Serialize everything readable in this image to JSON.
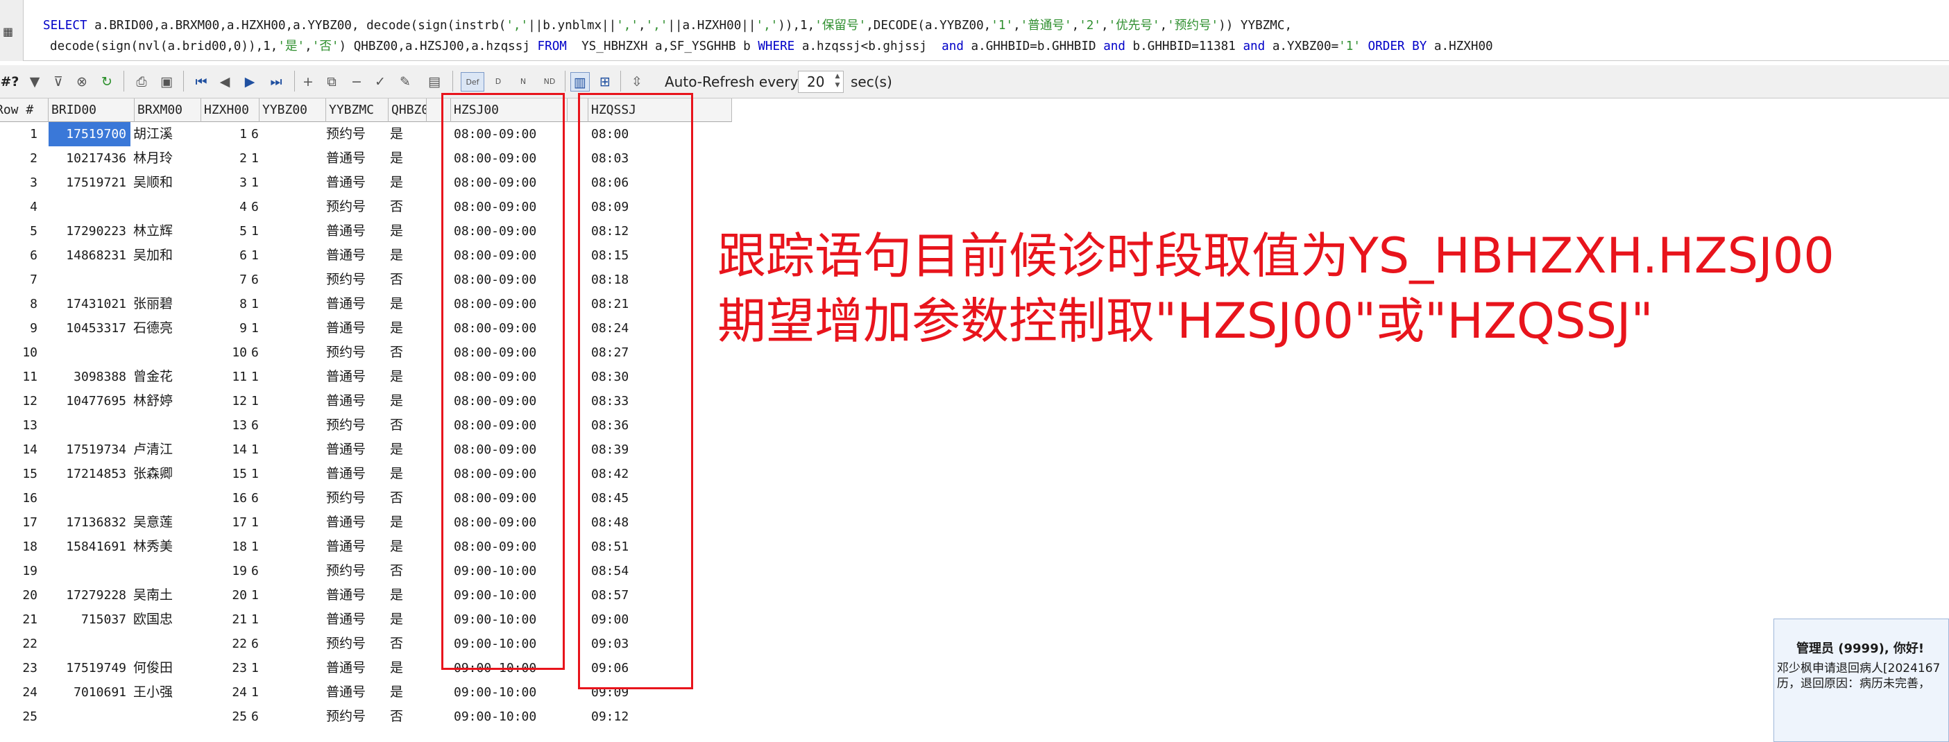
{
  "sql": {
    "line1": [
      {
        "t": "SELECT",
        "c": "kw"
      },
      {
        "t": " a.BRID00,a.BRXM00,a.HZXH00,a.YYBZ00, decode(sign(instrb(",
        "c": ""
      },
      {
        "t": "','",
        "c": "str"
      },
      {
        "t": "||b.ynblmx||",
        "c": ""
      },
      {
        "t": "','",
        "c": "str"
      },
      {
        "t": ",",
        "c": ""
      },
      {
        "t": "','",
        "c": "str"
      },
      {
        "t": "||a.HZXH00||",
        "c": ""
      },
      {
        "t": "','",
        "c": "str"
      },
      {
        "t": ")),1,",
        "c": ""
      },
      {
        "t": "'保留号'",
        "c": "str"
      },
      {
        "t": ",DECODE(a.YYBZ00,",
        "c": ""
      },
      {
        "t": "'1'",
        "c": "str"
      },
      {
        "t": ",",
        "c": ""
      },
      {
        "t": "'普通号'",
        "c": "str"
      },
      {
        "t": ",",
        "c": ""
      },
      {
        "t": "'2'",
        "c": "str"
      },
      {
        "t": ",",
        "c": ""
      },
      {
        "t": "'优先号'",
        "c": "str"
      },
      {
        "t": ",",
        "c": ""
      },
      {
        "t": "'预约号'",
        "c": "str"
      },
      {
        "t": ")) YYBZMC,",
        "c": ""
      }
    ],
    "line2": [
      {
        "t": "decode(sign(nvl(a.brid00,0)),1,",
        "c": ""
      },
      {
        "t": "'是'",
        "c": "str"
      },
      {
        "t": ",",
        "c": ""
      },
      {
        "t": "'否'",
        "c": "str"
      },
      {
        "t": ") QHBZ00,a.HZSJ00,a.hzqssj ",
        "c": ""
      },
      {
        "t": "FROM",
        "c": "kw"
      },
      {
        "t": "  YS_HBHZXH a,SF_YSGHHB b ",
        "c": ""
      },
      {
        "t": "WHERE",
        "c": "kw"
      },
      {
        "t": " a.hzqssj<b.ghjssj  ",
        "c": ""
      },
      {
        "t": "and",
        "c": "kw"
      },
      {
        "t": " a.GHHBID=b.GHHBID ",
        "c": ""
      },
      {
        "t": "and",
        "c": "kw"
      },
      {
        "t": " b.GHHBID=11381 ",
        "c": ""
      },
      {
        "t": "and",
        "c": "kw"
      },
      {
        "t": " a.YXBZ00=",
        "c": ""
      },
      {
        "t": "'1'",
        "c": "str"
      },
      {
        "t": " ",
        "c": ""
      },
      {
        "t": "ORDER BY",
        "c": "kw"
      },
      {
        "t": " a.HZXH00",
        "c": ""
      }
    ]
  },
  "toolbar": {
    "row_count_label": "#?",
    "auto_refresh_label": "Auto-Refresh every",
    "refresh_interval": "20",
    "refresh_unit": "sec(s)",
    "def_label": "Def",
    "d_label": "D",
    "n_label": "N",
    "nd_label": "ND"
  },
  "grid": {
    "columns": [
      "Row #",
      "BRID00",
      "BRXM00",
      "HZXH00",
      "YYBZ00",
      "YYBZMC",
      "QHBZ00",
      "",
      "HZSJ00",
      "",
      "HZQSSJ"
    ],
    "rows": [
      {
        "row": "1",
        "brid": "17519700",
        "name": "胡江溪",
        "hzxh": "1",
        "yybz": "6",
        "mc": "预约号",
        "qh": "是",
        "hzsj": "08:00-09:00",
        "qssj": "08:00"
      },
      {
        "row": "2",
        "brid": "10217436",
        "name": "林月玲",
        "hzxh": "2",
        "yybz": "1",
        "mc": "普通号",
        "qh": "是",
        "hzsj": "08:00-09:00",
        "qssj": "08:03"
      },
      {
        "row": "3",
        "brid": "17519721",
        "name": "吴顺和",
        "hzxh": "3",
        "yybz": "1",
        "mc": "普通号",
        "qh": "是",
        "hzsj": "08:00-09:00",
        "qssj": "08:06"
      },
      {
        "row": "4",
        "brid": "",
        "name": "",
        "hzxh": "4",
        "yybz": "6",
        "mc": "预约号",
        "qh": "否",
        "hzsj": "08:00-09:00",
        "qssj": "08:09"
      },
      {
        "row": "5",
        "brid": "17290223",
        "name": "林立辉",
        "hzxh": "5",
        "yybz": "1",
        "mc": "普通号",
        "qh": "是",
        "hzsj": "08:00-09:00",
        "qssj": "08:12"
      },
      {
        "row": "6",
        "brid": "14868231",
        "name": "吴加和",
        "hzxh": "6",
        "yybz": "1",
        "mc": "普通号",
        "qh": "是",
        "hzsj": "08:00-09:00",
        "qssj": "08:15"
      },
      {
        "row": "7",
        "brid": "",
        "name": "",
        "hzxh": "7",
        "yybz": "6",
        "mc": "预约号",
        "qh": "否",
        "hzsj": "08:00-09:00",
        "qssj": "08:18"
      },
      {
        "row": "8",
        "brid": "17431021",
        "name": "张丽碧",
        "hzxh": "8",
        "yybz": "1",
        "mc": "普通号",
        "qh": "是",
        "hzsj": "08:00-09:00",
        "qssj": "08:21"
      },
      {
        "row": "9",
        "brid": "10453317",
        "name": "石德亮",
        "hzxh": "9",
        "yybz": "1",
        "mc": "普通号",
        "qh": "是",
        "hzsj": "08:00-09:00",
        "qssj": "08:24"
      },
      {
        "row": "10",
        "brid": "",
        "name": "",
        "hzxh": "10",
        "yybz": "6",
        "mc": "预约号",
        "qh": "否",
        "hzsj": "08:00-09:00",
        "qssj": "08:27"
      },
      {
        "row": "11",
        "brid": "3098388",
        "name": "曾金花",
        "hzxh": "11",
        "yybz": "1",
        "mc": "普通号",
        "qh": "是",
        "hzsj": "08:00-09:00",
        "qssj": "08:30"
      },
      {
        "row": "12",
        "brid": "10477695",
        "name": "林舒婷",
        "hzxh": "12",
        "yybz": "1",
        "mc": "普通号",
        "qh": "是",
        "hzsj": "08:00-09:00",
        "qssj": "08:33"
      },
      {
        "row": "13",
        "brid": "",
        "name": "",
        "hzxh": "13",
        "yybz": "6",
        "mc": "预约号",
        "qh": "否",
        "hzsj": "08:00-09:00",
        "qssj": "08:36"
      },
      {
        "row": "14",
        "brid": "17519734",
        "name": "卢清江",
        "hzxh": "14",
        "yybz": "1",
        "mc": "普通号",
        "qh": "是",
        "hzsj": "08:00-09:00",
        "qssj": "08:39"
      },
      {
        "row": "15",
        "brid": "17214853",
        "name": "张森卿",
        "hzxh": "15",
        "yybz": "1",
        "mc": "普通号",
        "qh": "是",
        "hzsj": "08:00-09:00",
        "qssj": "08:42"
      },
      {
        "row": "16",
        "brid": "",
        "name": "",
        "hzxh": "16",
        "yybz": "6",
        "mc": "预约号",
        "qh": "否",
        "hzsj": "08:00-09:00",
        "qssj": "08:45"
      },
      {
        "row": "17",
        "brid": "17136832",
        "name": "吴意莲",
        "hzxh": "17",
        "yybz": "1",
        "mc": "普通号",
        "qh": "是",
        "hzsj": "08:00-09:00",
        "qssj": "08:48"
      },
      {
        "row": "18",
        "brid": "15841691",
        "name": "林秀美",
        "hzxh": "18",
        "yybz": "1",
        "mc": "普通号",
        "qh": "是",
        "hzsj": "08:00-09:00",
        "qssj": "08:51"
      },
      {
        "row": "19",
        "brid": "",
        "name": "",
        "hzxh": "19",
        "yybz": "6",
        "mc": "预约号",
        "qh": "否",
        "hzsj": "09:00-10:00",
        "qssj": "08:54"
      },
      {
        "row": "20",
        "brid": "17279228",
        "name": "吴南土",
        "hzxh": "20",
        "yybz": "1",
        "mc": "普通号",
        "qh": "是",
        "hzsj": "09:00-10:00",
        "qssj": "08:57"
      },
      {
        "row": "21",
        "brid": "715037",
        "name": "欧国忠",
        "hzxh": "21",
        "yybz": "1",
        "mc": "普通号",
        "qh": "是",
        "hzsj": "09:00-10:00",
        "qssj": "09:00"
      },
      {
        "row": "22",
        "brid": "",
        "name": "",
        "hzxh": "22",
        "yybz": "6",
        "mc": "预约号",
        "qh": "否",
        "hzsj": "09:00-10:00",
        "qssj": "09:03"
      },
      {
        "row": "23",
        "brid": "17519749",
        "name": "何俊田",
        "hzxh": "23",
        "yybz": "1",
        "mc": "普通号",
        "qh": "是",
        "hzsj": "09:00-10:00",
        "qssj": "09:06"
      },
      {
        "row": "24",
        "brid": "7010691",
        "name": "王小强",
        "hzxh": "24",
        "yybz": "1",
        "mc": "普通号",
        "qh": "是",
        "hzsj": "09:00-10:00",
        "qssj": "09:09"
      },
      {
        "row": "25",
        "brid": "",
        "name": "",
        "hzxh": "25",
        "yybz": "6",
        "mc": "预约号",
        "qh": "否",
        "hzsj": "09:00-10:00",
        "qssj": "09:12"
      }
    ]
  },
  "annotation": {
    "line1": "跟踪语句目前候诊时段取值为YS_HBHZXH.HZSJ00",
    "line2": "期望增加参数控制取\"HZSJ00\"或\"HZQSSJ\""
  },
  "notification": {
    "title": "管理员 (9999), 你好!",
    "text_line1": "邓少枫申请退回病人[2024167",
    "text_line2": "历，退回原因：病历未完善，"
  },
  "colors": {
    "annotation_red": "#e8141c",
    "selection_blue": "#3a78d8",
    "sql_keyword": "#0000c8",
    "sql_string": "#2f8f2f"
  },
  "selected": {
    "row_index": 0,
    "column": "brid"
  }
}
